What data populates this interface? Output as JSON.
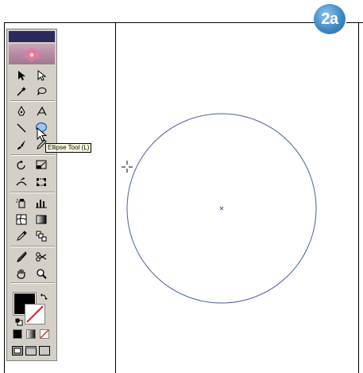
{
  "step_badge": "2a",
  "tooltip": "Ellipse Tool (L)",
  "tools": {
    "selection": "selection-tool",
    "direct_selection": "direct-selection-tool",
    "magic_wand": "magic-wand-tool",
    "lasso": "lasso-tool",
    "pen": "pen-tool",
    "type": "type-tool",
    "line": "line-segment-tool",
    "ellipse": "ellipse-tool",
    "paintbrush": "paintbrush-tool",
    "pencil": "pencil-tool",
    "rotate": "rotate-tool",
    "scale": "scale-tool",
    "warp": "warp-tool",
    "free_transform": "free-transform-tool",
    "symbol_sprayer": "symbol-sprayer-tool",
    "graph": "graph-tool",
    "mesh": "mesh-tool",
    "gradient": "gradient-tool",
    "eyedropper": "eyedropper-tool",
    "blend": "blend-tool",
    "slice": "slice-tool",
    "scissors": "scissors-tool",
    "hand": "hand-tool",
    "zoom": "zoom-tool"
  },
  "colors": {
    "fill": "#000000",
    "stroke": "none",
    "ellipse_stroke": "#4a5fa8"
  }
}
